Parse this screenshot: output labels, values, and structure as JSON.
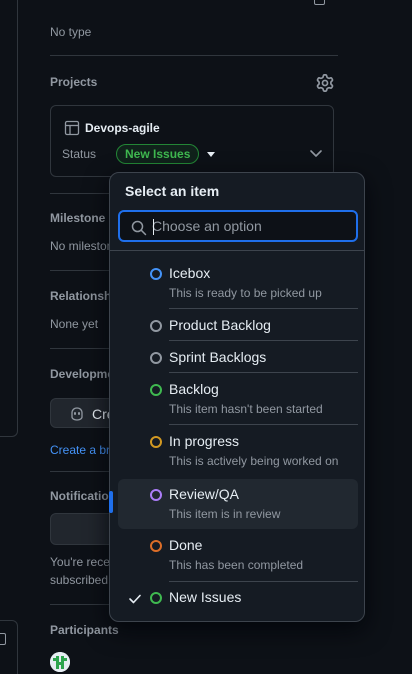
{
  "sidebar": {
    "type_value": "No type",
    "projects": {
      "title": "Projects",
      "project_name": "Devops-agile",
      "status_label": "Status",
      "status_value": "New Issues"
    },
    "milestone": {
      "title": "Milestone",
      "value": "No milestone"
    },
    "relationships": {
      "title": "Relationships",
      "value": "None yet"
    },
    "development": {
      "title": "Development",
      "button_label": "Create branch",
      "link": "Create a branch"
    },
    "notifications": {
      "title": "Notifications",
      "text_line1": "You're receiving notifications because you're",
      "text_line2": "subscribed to this thread."
    },
    "participants": {
      "title": "Participants"
    }
  },
  "dropdown": {
    "title": "Select an item",
    "search_placeholder": "Choose an option",
    "options": [
      {
        "label": "Icebox",
        "description": "This is ready to be picked up",
        "color": "#4493f8"
      },
      {
        "label": "Product Backlog",
        "description": "",
        "color": "#9198a1"
      },
      {
        "label": "Sprint Backlogs",
        "description": "",
        "color": "#9198a1"
      },
      {
        "label": "Backlog",
        "description": "This item hasn't been started",
        "color": "#3fb950"
      },
      {
        "label": "In progress",
        "description": "This is actively being worked on",
        "color": "#d29922"
      },
      {
        "label": "Review/QA",
        "description": "This item is in review",
        "color": "#ab7df8"
      },
      {
        "label": "Done",
        "description": "This has been completed",
        "color": "#db6d28"
      },
      {
        "label": "New Issues",
        "description": "",
        "color": "#3fb950",
        "selected": true
      }
    ]
  },
  "colors": {
    "accent": "#1f6feb",
    "badge_green": "#3fb950"
  }
}
